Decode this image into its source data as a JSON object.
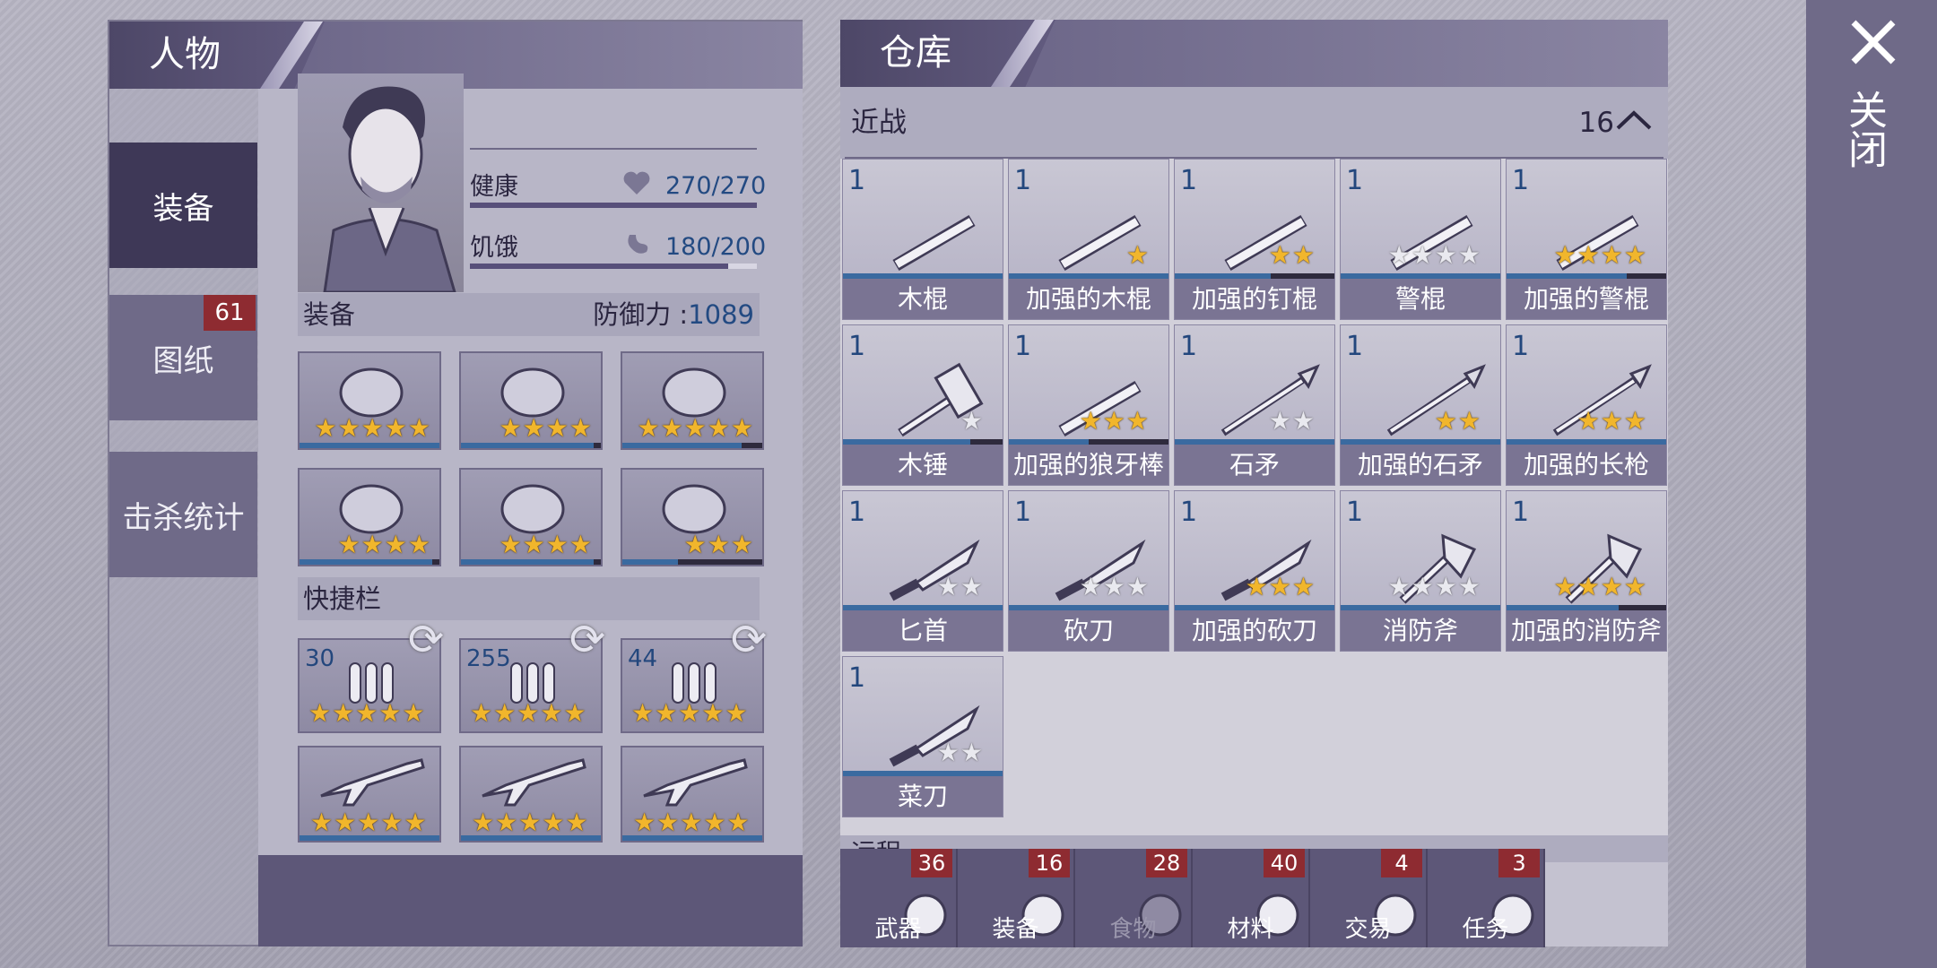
{
  "character": {
    "title": "人物",
    "tabs": [
      {
        "label": "装备",
        "active": true
      },
      {
        "label": "图纸",
        "badge": "61"
      },
      {
        "label": "击杀统计"
      }
    ],
    "stats": [
      {
        "label": "健康",
        "value": "270/270",
        "fill": 1.0,
        "icon": "heart-icon"
      },
      {
        "label": "饥饿",
        "value": "180/200",
        "fill": 0.9,
        "icon": "stomach-icon"
      }
    ],
    "equipment_label": "装备",
    "defense_label": "防御力 :",
    "defense_value": "1089",
    "equipment_slots": [
      {
        "icon": "rooster-mask-icon",
        "stars": 5,
        "color": "gold",
        "durability": 1.0
      },
      {
        "icon": "body-armor-icon",
        "stars": 4,
        "color": "gold",
        "durability": 0.95
      },
      {
        "icon": "turtle-shell-icon",
        "stars": 5,
        "color": "gold",
        "durability": 0.85
      },
      {
        "icon": "gloves-icon",
        "stars": 4,
        "color": "gold",
        "durability": 0.95
      },
      {
        "icon": "pants-icon",
        "stars": 4,
        "color": "gold",
        "durability": 0.95
      },
      {
        "icon": "sneakers-icon",
        "stars": 3,
        "color": "gold",
        "durability": 0.4
      }
    ],
    "quickbar_label": "快捷栏",
    "quickbar_ammo": [
      {
        "qty": "30",
        "icon": "rifle-ammo-icon",
        "stars": 5
      },
      {
        "qty": "255",
        "icon": "shotgun-shells-icon",
        "stars": 5
      },
      {
        "qty": "44",
        "icon": "rifle-ammo-icon",
        "stars": 5
      }
    ],
    "quickbar_guns": [
      {
        "icon": "assault-rifle-icon",
        "stars": 5
      },
      {
        "icon": "shotgun-icon",
        "stars": 5
      },
      {
        "icon": "sniper-rifle-icon",
        "stars": 5
      }
    ]
  },
  "warehouse": {
    "title": "仓库",
    "category": "近战",
    "category_count": "16",
    "next_category": "远程",
    "items": [
      {
        "qty": "1",
        "name": "木棍",
        "stars": 0,
        "star_color": "gold",
        "icon": "wood-stick-icon",
        "durability": 1.0
      },
      {
        "qty": "1",
        "name": "加强的木棍",
        "stars": 1,
        "star_color": "gold",
        "icon": "reinforced-stick-icon",
        "durability": 1.0
      },
      {
        "qty": "1",
        "name": "加强的钉棍",
        "stars": 2,
        "star_color": "gold",
        "icon": "spiked-club-icon",
        "durability": 0.6
      },
      {
        "qty": "1",
        "name": "警棍",
        "stars": 4,
        "star_color": "silver",
        "icon": "baton-icon",
        "durability": 1.0
      },
      {
        "qty": "1",
        "name": "加强的警棍",
        "stars": 4,
        "star_color": "gold",
        "icon": "reinforced-baton-icon",
        "durability": 0.75
      },
      {
        "qty": "1",
        "name": "木锤",
        "stars": 1,
        "star_color": "silver",
        "icon": "wood-hammer-icon",
        "durability": 0.8
      },
      {
        "qty": "1",
        "name": "加强的狼牙棒",
        "stars": 3,
        "star_color": "gold",
        "icon": "mace-icon",
        "durability": 0.5
      },
      {
        "qty": "1",
        "name": "石矛",
        "stars": 2,
        "star_color": "silver",
        "icon": "stone-spear-icon",
        "durability": 1.0
      },
      {
        "qty": "1",
        "name": "加强的石矛",
        "stars": 2,
        "star_color": "gold",
        "icon": "reinforced-spear-icon",
        "durability": 1.0
      },
      {
        "qty": "1",
        "name": "加强的长枪",
        "stars": 3,
        "star_color": "gold",
        "icon": "long-spear-icon",
        "durability": 1.0
      },
      {
        "qty": "1",
        "name": "匕首",
        "stars": 2,
        "star_color": "silver",
        "icon": "dagger-icon",
        "durability": 1.0
      },
      {
        "qty": "1",
        "name": "砍刀",
        "stars": 3,
        "star_color": "silver",
        "icon": "machete-icon",
        "durability": 1.0
      },
      {
        "qty": "1",
        "name": "加强的砍刀",
        "stars": 3,
        "star_color": "gold",
        "icon": "reinforced-machete-icon",
        "durability": 1.0
      },
      {
        "qty": "1",
        "name": "消防斧",
        "stars": 4,
        "star_color": "silver",
        "icon": "fire-axe-icon",
        "durability": 1.0
      },
      {
        "qty": "1",
        "name": "加强的消防斧",
        "stars": 4,
        "star_color": "gold",
        "icon": "reinforced-axe-icon",
        "durability": 0.7
      },
      {
        "qty": "1",
        "name": "菜刀",
        "stars": 2,
        "star_color": "silver",
        "icon": "cleaver-icon",
        "durability": 1.0
      }
    ],
    "bottom_tabs": [
      {
        "label": "武器",
        "badge": "36",
        "icon": "axe-icon",
        "dim": false
      },
      {
        "label": "装备",
        "badge": "16",
        "icon": "shirt-icon",
        "dim": false
      },
      {
        "label": "食物",
        "badge": "28",
        "icon": "meat-icon",
        "dim": true
      },
      {
        "label": "材料",
        "badge": "40",
        "icon": "logs-icon",
        "dim": false
      },
      {
        "label": "交易",
        "badge": "4",
        "icon": "coin-icon",
        "dim": false
      },
      {
        "label": "任务",
        "badge": "3",
        "icon": "key-icon",
        "dim": false
      }
    ]
  },
  "close_label": "关闭",
  "colors": {
    "panel_dark": "#3e3857",
    "accent_blue": "#3a6aa0",
    "badge_red": "#8e2b31",
    "star_gold": "#f1b62c"
  }
}
